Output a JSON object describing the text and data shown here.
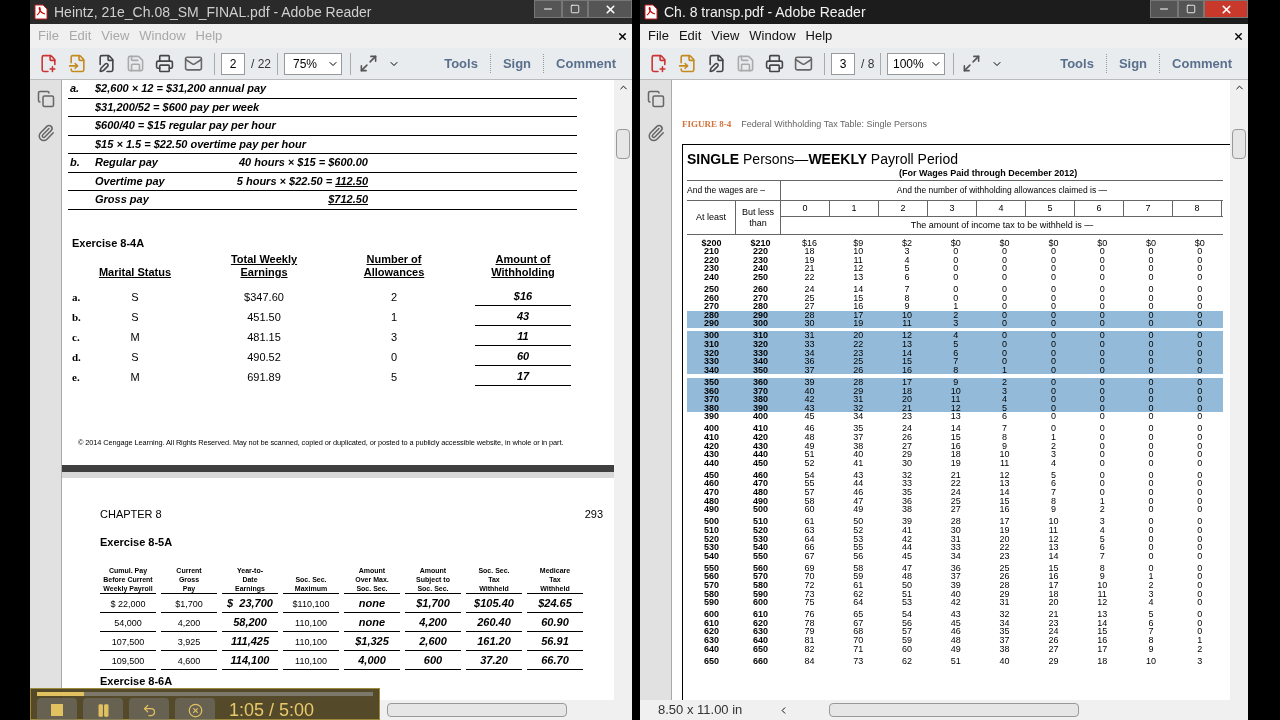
{
  "left_window": {
    "title": "Heintz, 21e_Ch.08_SM_FINAL.pdf - Adobe Reader",
    "active": false,
    "menu": [
      "File",
      "Edit",
      "View",
      "Window",
      "Help"
    ],
    "page": "2",
    "page_count": "/ 22",
    "zoom": "75%",
    "toolbar_links": [
      "Tools",
      "Sign",
      "Comment"
    ],
    "solution_lines": [
      {
        "label": "a.",
        "text": "$2,600 × 12 = $31,200 annual pay"
      },
      {
        "text": "$31,200/52 = $600 pay per week"
      },
      {
        "text": "$600/40 = $15 regular pay per hour"
      },
      {
        "text": "$15 × 1.5 = $22.50 overtime pay per hour"
      },
      {
        "label": "b.",
        "text": "Regular pay",
        "calc": "40 hours × $15 = $600.00"
      },
      {
        "text": "Overtime pay",
        "calc": "5 hours × $22.50 =",
        "amount": "112.50"
      },
      {
        "text": "Gross pay",
        "amount": "$712.50"
      }
    ],
    "exercise_4a": {
      "title": "Exercise 8-4A",
      "columns": [
        "Marital Status",
        "Total Weekly Earnings",
        "Number of Allowances",
        "Amount of Withholding"
      ],
      "rows": [
        {
          "label": "a.",
          "cells": [
            "S",
            "$347.60",
            "2",
            "$16"
          ]
        },
        {
          "label": "b.",
          "cells": [
            "S",
            "451.50",
            "1",
            "43"
          ]
        },
        {
          "label": "c.",
          "cells": [
            "M",
            "481.15",
            "3",
            "11"
          ]
        },
        {
          "label": "d.",
          "cells": [
            "S",
            "490.52",
            "0",
            "60"
          ]
        },
        {
          "label": "e.",
          "cells": [
            "M",
            "691.89",
            "5",
            "17"
          ]
        }
      ]
    },
    "copyright": "© 2014 Cengage Learning. All Rights Reserved. May not be scanned, copied or duplicated, or posted to a publicly accessible website, in whole or in part.",
    "chapter": "CHAPTER 8",
    "page_number": "293",
    "exercise_5a": {
      "title": "Exercise 8-5A",
      "columns": [
        {
          "lines": [
            "Cumul. Pay",
            "Before Current",
            "Weekly Payroll"
          ],
          "emphasis": false
        },
        {
          "lines": [
            "Current",
            "Gross",
            "Pay"
          ],
          "emphasis": false
        },
        {
          "lines": [
            "Year-to-",
            "Date",
            "Earnings"
          ],
          "emphasis": true
        },
        {
          "lines": [
            "Soc. Sec.",
            "Maximum"
          ],
          "emphasis": false
        },
        {
          "lines": [
            "Amount",
            "Over Max.",
            "Soc. Sec."
          ],
          "emphasis": true
        },
        {
          "lines": [
            "Amount",
            "Subject to",
            "Soc. Sec."
          ],
          "emphasis": true
        },
        {
          "lines": [
            "Soc. Sec.",
            "Tax",
            "Withheld"
          ],
          "emphasis": true
        },
        {
          "lines": [
            "Medicare",
            "Tax",
            "Withheld"
          ],
          "emphasis": true
        }
      ],
      "rows": [
        [
          "$ 22,000",
          "$1,700",
          "$  23,700",
          "$110,100",
          "none",
          "$1,700",
          "$105.40",
          "$24.65"
        ],
        [
          "54,000",
          "4,200",
          "58,200",
          "110,100",
          "none",
          "4,200",
          "260.40",
          "60.90"
        ],
        [
          "107,500",
          "3,925",
          "111,425",
          "110,100",
          "$1,325",
          "2,600",
          "161.20",
          "56.91"
        ],
        [
          "109,500",
          "4,600",
          "114,100",
          "110,100",
          "4,000",
          "600",
          "37.20",
          "66.70"
        ]
      ]
    },
    "next_exercise": "Exercise 8-6A",
    "player": {
      "time": "1:05 / 5:00",
      "level": 0.14
    }
  },
  "right_window": {
    "title": "Ch. 8 transp.pdf - Adobe Reader",
    "active": true,
    "menu": [
      "File",
      "Edit",
      "View",
      "Window",
      "Help"
    ],
    "page": "3",
    "page_count": "/ 8",
    "zoom": "100%",
    "toolbar_links": [
      "Tools",
      "Sign",
      "Comment"
    ],
    "status": "8.50 x 11.00 in",
    "figure_label": "FIGURE 8-4",
    "figure_caption": "Federal Withholding Tax Table: Single Persons",
    "table": {
      "title": "**SINGLE** Persons—**WEEKLY** Payroll Period",
      "subtitle": "(For Wages Paid through December 2012)",
      "wages_heading": "And the wages are –",
      "allowances_heading": "And the number of withholding allowances claimed is —",
      "at_least": "At least",
      "but_less_than": "But less than",
      "allowances": [
        "0",
        "1",
        "2",
        "3",
        "4",
        "5",
        "6",
        "7",
        "8"
      ],
      "amount_heading": "The amount of income tax to be withheld is —",
      "groups": [
        {
          "rows": [
            {
              "cells": [
                "$200",
                "$210",
                "$16",
                "$9",
                "$2",
                "$0",
                "$0",
                "$0",
                "$0",
                "$0",
                "$0"
              ],
              "highlighted": false
            },
            {
              "cells": [
                "210",
                "220",
                "18",
                "10",
                "3",
                "0",
                "0",
                "0",
                "0",
                "0",
                "0"
              ],
              "highlighted": false
            },
            {
              "cells": [
                "220",
                "230",
                "19",
                "11",
                "4",
                "0",
                "0",
                "0",
                "0",
                "0",
                "0"
              ],
              "highlighted": false
            },
            {
              "cells": [
                "230",
                "240",
                "21",
                "12",
                "5",
                "0",
                "0",
                "0",
                "0",
                "0",
                "0"
              ],
              "highlighted": false
            },
            {
              "cells": [
                "240",
                "250",
                "22",
                "13",
                "6",
                "0",
                "0",
                "0",
                "0",
                "0",
                "0"
              ],
              "highlighted": false
            }
          ]
        },
        {
          "rows": [
            {
              "cells": [
                "250",
                "260",
                "24",
                "14",
                "7",
                "0",
                "0",
                "0",
                "0",
                "0",
                "0"
              ],
              "highlighted": false
            },
            {
              "cells": [
                "260",
                "270",
                "25",
                "15",
                "8",
                "0",
                "0",
                "0",
                "0",
                "0",
                "0"
              ],
              "highlighted": false
            },
            {
              "cells": [
                "270",
                "280",
                "27",
                "16",
                "9",
                "1",
                "0",
                "0",
                "0",
                "0",
                "0"
              ],
              "highlighted": false
            },
            {
              "cells": [
                "280",
                "290",
                "28",
                "17",
                "10",
                "2",
                "0",
                "0",
                "0",
                "0",
                "0"
              ],
              "highlighted": true
            },
            {
              "cells": [
                "290",
                "300",
                "30",
                "19",
                "11",
                "3",
                "0",
                "0",
                "0",
                "0",
                "0"
              ],
              "highlighted": true
            }
          ]
        },
        {
          "rows": [
            {
              "cells": [
                "300",
                "310",
                "31",
                "20",
                "12",
                "4",
                "0",
                "0",
                "0",
                "0",
                "0"
              ],
              "highlighted": true
            },
            {
              "cells": [
                "310",
                "320",
                "33",
                "22",
                "13",
                "5",
                "0",
                "0",
                "0",
                "0",
                "0"
              ],
              "highlighted": true
            },
            {
              "cells": [
                "320",
                "330",
                "34",
                "23",
                "14",
                "6",
                "0",
                "0",
                "0",
                "0",
                "0"
              ],
              "highlighted": true
            },
            {
              "cells": [
                "330",
                "340",
                "36",
                "25",
                "15",
                "7",
                "0",
                "0",
                "0",
                "0",
                "0"
              ],
              "highlighted": true
            },
            {
              "cells": [
                "340",
                "350",
                "37",
                "26",
                "16",
                "8",
                "1",
                "0",
                "0",
                "0",
                "0"
              ],
              "highlighted": true
            }
          ]
        },
        {
          "rows": [
            {
              "cells": [
                "350",
                "360",
                "39",
                "28",
                "17",
                "9",
                "2",
                "0",
                "0",
                "0",
                "0"
              ],
              "highlighted": true
            },
            {
              "cells": [
                "360",
                "370",
                "40",
                "29",
                "18",
                "10",
                "3",
                "0",
                "0",
                "0",
                "0"
              ],
              "highlighted": true
            },
            {
              "cells": [
                "370",
                "380",
                "42",
                "31",
                "20",
                "11",
                "4",
                "0",
                "0",
                "0",
                "0"
              ],
              "highlighted": true
            },
            {
              "cells": [
                "380",
                "390",
                "43",
                "32",
                "21",
                "12",
                "5",
                "0",
                "0",
                "0",
                "0"
              ],
              "highlighted": true
            },
            {
              "cells": [
                "390",
                "400",
                "45",
                "34",
                "23",
                "13",
                "6",
                "0",
                "0",
                "0",
                "0"
              ],
              "highlighted": false
            }
          ]
        },
        {
          "rows": [
            {
              "cells": [
                "400",
                "410",
                "46",
                "35",
                "24",
                "14",
                "7",
                "0",
                "0",
                "0",
                "0"
              ],
              "highlighted": false
            },
            {
              "cells": [
                "410",
                "420",
                "48",
                "37",
                "26",
                "15",
                "8",
                "1",
                "0",
                "0",
                "0"
              ],
              "highlighted": false
            },
            {
              "cells": [
                "420",
                "430",
                "49",
                "38",
                "27",
                "16",
                "9",
                "2",
                "0",
                "0",
                "0"
              ],
              "highlighted": false
            },
            {
              "cells": [
                "430",
                "440",
                "51",
                "40",
                "29",
                "18",
                "10",
                "3",
                "0",
                "0",
                "0"
              ],
              "highlighted": false
            },
            {
              "cells": [
                "440",
                "450",
                "52",
                "41",
                "30",
                "19",
                "11",
                "4",
                "0",
                "0",
                "0"
              ],
              "highlighted": false
            }
          ]
        },
        {
          "rows": [
            {
              "cells": [
                "450",
                "460",
                "54",
                "43",
                "32",
                "21",
                "12",
                "5",
                "0",
                "0",
                "0"
              ],
              "highlighted": false
            },
            {
              "cells": [
                "460",
                "470",
                "55",
                "44",
                "33",
                "22",
                "13",
                "6",
                "0",
                "0",
                "0"
              ],
              "highlighted": false
            },
            {
              "cells": [
                "470",
                "480",
                "57",
                "46",
                "35",
                "24",
                "14",
                "7",
                "0",
                "0",
                "0"
              ],
              "highlighted": false
            },
            {
              "cells": [
                "480",
                "490",
                "58",
                "47",
                "36",
                "25",
                "15",
                "8",
                "1",
                "0",
                "0"
              ],
              "highlighted": false
            },
            {
              "cells": [
                "490",
                "500",
                "60",
                "49",
                "38",
                "27",
                "16",
                "9",
                "2",
                "0",
                "0"
              ],
              "highlighted": false
            }
          ]
        },
        {
          "rows": [
            {
              "cells": [
                "500",
                "510",
                "61",
                "50",
                "39",
                "28",
                "17",
                "10",
                "3",
                "0",
                "0"
              ],
              "highlighted": false
            },
            {
              "cells": [
                "510",
                "520",
                "63",
                "52",
                "41",
                "30",
                "19",
                "11",
                "4",
                "0",
                "0"
              ],
              "highlighted": false
            },
            {
              "cells": [
                "520",
                "530",
                "64",
                "53",
                "42",
                "31",
                "20",
                "12",
                "5",
                "0",
                "0"
              ],
              "highlighted": false
            },
            {
              "cells": [
                "530",
                "540",
                "66",
                "55",
                "44",
                "33",
                "22",
                "13",
                "6",
                "0",
                "0"
              ],
              "highlighted": false
            },
            {
              "cells": [
                "540",
                "550",
                "67",
                "56",
                "45",
                "34",
                "23",
                "14",
                "7",
                "0",
                "0"
              ],
              "highlighted": false
            }
          ]
        },
        {
          "rows": [
            {
              "cells": [
                "550",
                "560",
                "69",
                "58",
                "47",
                "36",
                "25",
                "15",
                "8",
                "0",
                "0"
              ],
              "highlighted": false
            },
            {
              "cells": [
                "560",
                "570",
                "70",
                "59",
                "48",
                "37",
                "26",
                "16",
                "9",
                "1",
                "0"
              ],
              "highlighted": false
            },
            {
              "cells": [
                "570",
                "580",
                "72",
                "61",
                "50",
                "39",
                "28",
                "17",
                "10",
                "2",
                "0"
              ],
              "highlighted": false
            },
            {
              "cells": [
                "580",
                "590",
                "73",
                "62",
                "51",
                "40",
                "29",
                "18",
                "11",
                "3",
                "0"
              ],
              "highlighted": false
            },
            {
              "cells": [
                "590",
                "600",
                "75",
                "64",
                "53",
                "42",
                "31",
                "20",
                "12",
                "4",
                "0"
              ],
              "highlighted": false
            }
          ]
        },
        {
          "rows": [
            {
              "cells": [
                "600",
                "610",
                "76",
                "65",
                "54",
                "43",
                "32",
                "21",
                "13",
                "5",
                "0"
              ],
              "highlighted": false
            },
            {
              "cells": [
                "610",
                "620",
                "78",
                "67",
                "56",
                "45",
                "34",
                "23",
                "14",
                "6",
                "0"
              ],
              "highlighted": false
            },
            {
              "cells": [
                "620",
                "630",
                "79",
                "68",
                "57",
                "46",
                "35",
                "24",
                "15",
                "7",
                "0"
              ],
              "highlighted": false
            },
            {
              "cells": [
                "630",
                "640",
                "81",
                "70",
                "59",
                "48",
                "37",
                "26",
                "16",
                "8",
                "1"
              ],
              "highlighted": false
            },
            {
              "cells": [
                "640",
                "650",
                "82",
                "71",
                "60",
                "49",
                "38",
                "27",
                "17",
                "9",
                "2"
              ],
              "highlighted": false
            }
          ]
        },
        {
          "rows": [
            {
              "cells": [
                "650",
                "660",
                "84",
                "73",
                "62",
                "51",
                "40",
                "29",
                "18",
                "10",
                "3"
              ],
              "highlighted": false
            }
          ]
        }
      ]
    }
  }
}
